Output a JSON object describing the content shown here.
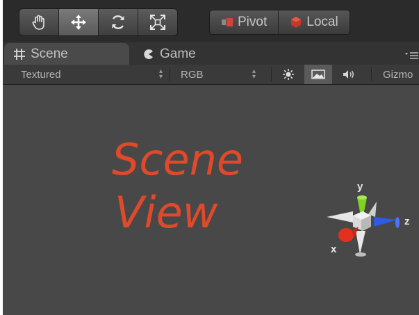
{
  "toolbar": {
    "tools": [
      {
        "icon": "hand-icon",
        "active": false
      },
      {
        "icon": "move-icon",
        "active": true
      },
      {
        "icon": "rotate-icon",
        "active": false
      },
      {
        "icon": "scale-icon",
        "active": false
      }
    ],
    "pivot_label": "Pivot",
    "local_label": "Local"
  },
  "tabs": {
    "scene_label": "Scene",
    "game_label": "Game"
  },
  "options": {
    "render_mode": "Textured",
    "color_mode": "RGB",
    "gizmos_label": "Gizmo"
  },
  "viewport": {
    "overlay_line1": "Scene",
    "overlay_line2": "View",
    "overlay_color": "#e04a2a"
  },
  "gizmo": {
    "y_label": "y",
    "x_label": "x",
    "z_label": "z",
    "colors": {
      "x": "#e2321e",
      "y": "#7ed321",
      "z": "#2d5be3"
    }
  }
}
